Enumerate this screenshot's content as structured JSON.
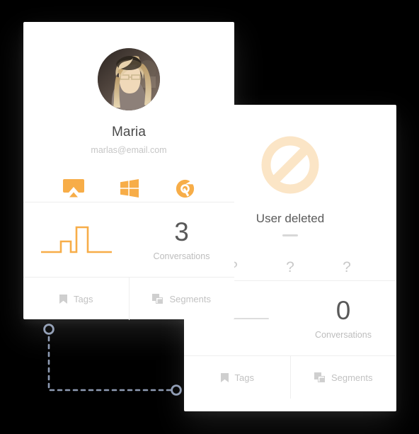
{
  "background_color": "#000000",
  "accent_color": "#f7ad48",
  "cards": {
    "front": {
      "name": "Maria",
      "email": "marlas@email.com",
      "devices": [
        {
          "icon": "airplay-icon",
          "label": "AirPlay"
        },
        {
          "icon": "windows-icon",
          "label": "Windows"
        },
        {
          "icon": "chrome-icon",
          "label": "Chrome"
        }
      ],
      "stats": {
        "conversations_value": "3",
        "conversations_label": "Conversations",
        "sparkline_icon": "step-chart-icon"
      },
      "tabs": [
        {
          "icon": "tag-icon",
          "label": "Tags"
        },
        {
          "icon": "segments-icon",
          "label": "Segments"
        }
      ]
    },
    "back": {
      "status_icon": "ban-icon",
      "status_title": "User deleted",
      "email_placeholder": "",
      "devices": [
        {
          "icon": "question-mark-icon",
          "label": "?"
        },
        {
          "icon": "question-mark-icon",
          "label": "?"
        },
        {
          "icon": "question-mark-icon",
          "label": "?"
        }
      ],
      "stats": {
        "conversations_value": "0",
        "conversations_label": "Conversations",
        "sparkline_icon": "flat-line-icon"
      },
      "tabs": [
        {
          "icon": "tag-icon",
          "label": "Tags"
        },
        {
          "icon": "segments-icon",
          "label": "Segments"
        }
      ]
    }
  },
  "connector": {
    "handle_color": "#8e9bb3",
    "line_color": "#8e9bb3",
    "style": "dashed"
  }
}
